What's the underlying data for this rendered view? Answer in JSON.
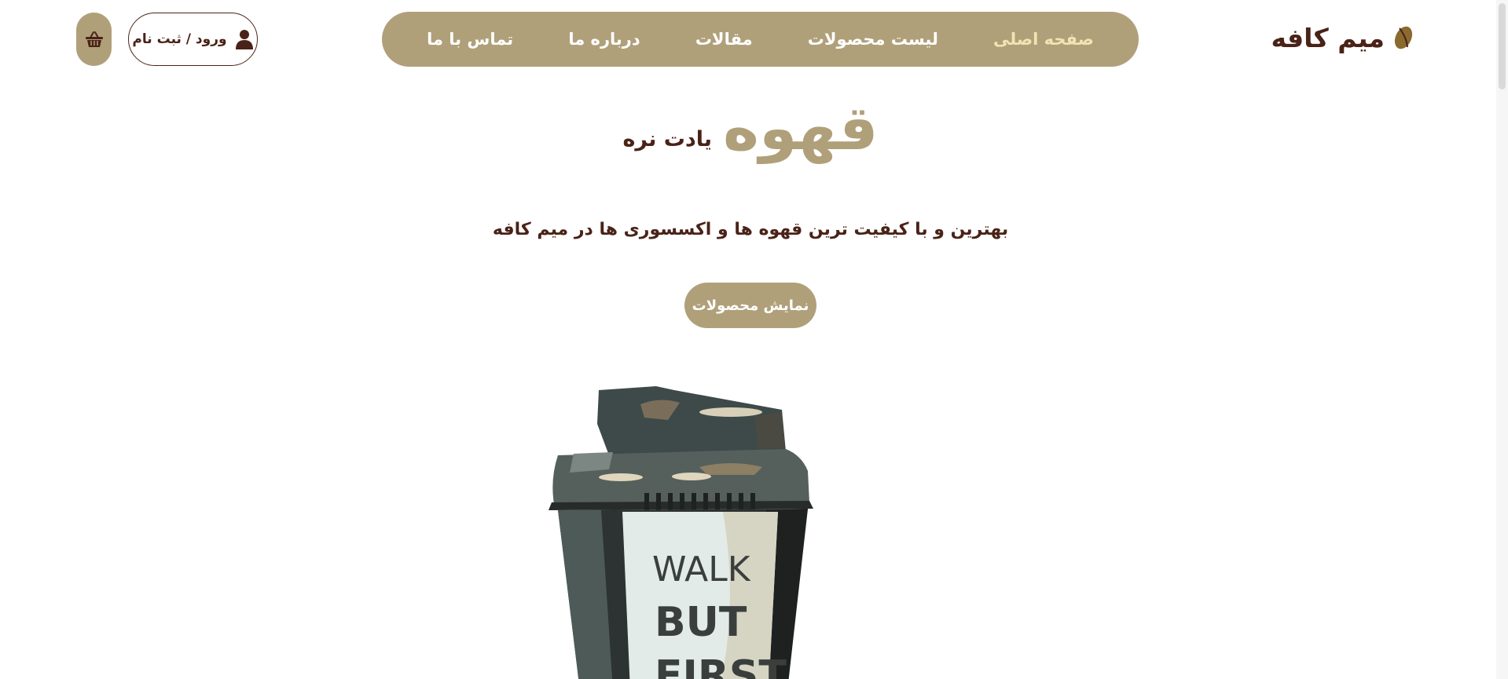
{
  "brand": {
    "name": "میم کافه",
    "icon": "coffee-bean-icon"
  },
  "nav": {
    "items": [
      {
        "label": "صفحه اصلی",
        "active": true
      },
      {
        "label": "لیست محصولات"
      },
      {
        "label": "مقالات"
      },
      {
        "label": "درباره ما"
      },
      {
        "label": "تماس با ما"
      }
    ]
  },
  "header": {
    "login_label": "ورود / ثبت نام",
    "login_icon": "user-icon",
    "cart_icon": "shopping-basket-icon"
  },
  "hero": {
    "title_highlight": "قهوه",
    "title_rest": "یادت نره",
    "subtitle": "بهترین و با کیفیت ترین قهوه ها و اکسسوری ها در میم کافه",
    "cta_label": "نمایش محصولات",
    "cup_text_line1": "WALK",
    "cup_text_line2": "BUT",
    "cup_text_line3": "FIRST"
  },
  "colors": {
    "primary": "#b0a07a",
    "dark": "#4a2217",
    "active_nav": "#f3e3b2",
    "background": "#ffffff"
  }
}
